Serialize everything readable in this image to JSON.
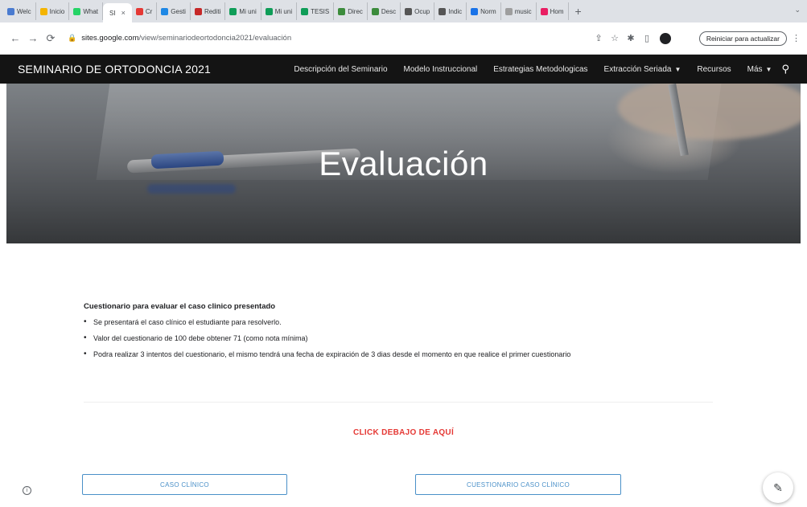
{
  "browser": {
    "tabs": [
      {
        "label": "Welc",
        "color": "#4a7bd0"
      },
      {
        "label": "Inicio",
        "color": "#f4b400"
      },
      {
        "label": "What",
        "color": "#25d366"
      },
      {
        "label": "SI",
        "color": "#ffffff",
        "active": true
      },
      {
        "label": "Cr",
        "color": "#e53935"
      },
      {
        "label": "Gesti",
        "color": "#1e88e5"
      },
      {
        "label": "Rediti",
        "color": "#c62828"
      },
      {
        "label": "Mi uni",
        "color": "#0f9d58"
      },
      {
        "label": "Mi uni",
        "color": "#0f9d58"
      },
      {
        "label": "TESIS",
        "color": "#0f9d58"
      },
      {
        "label": "Direc",
        "color": "#3c8c3c"
      },
      {
        "label": "Desc",
        "color": "#3c8c3c"
      },
      {
        "label": "Ocup",
        "color": "#555555"
      },
      {
        "label": "Indic",
        "color": "#555555"
      },
      {
        "label": "Norm",
        "color": "#1a73e8"
      },
      {
        "label": "music",
        "color": "#9e9e9e"
      },
      {
        "label": "Hom",
        "color": "#e91e63"
      }
    ],
    "active_tab_close": "×",
    "new_tab": "+",
    "url_domain": "sites.google.com",
    "url_path": "/view/seminariodeortodoncia2021/evaluación",
    "restart_label": "Reiniciar para actualizar"
  },
  "site": {
    "title": "SEMINARIO DE ORTODONCIA 2021",
    "nav": [
      {
        "label": "Descripción del Seminario"
      },
      {
        "label": "Modelo Instruccional"
      },
      {
        "label": "Estrategias Metodologicas"
      },
      {
        "label": "Extracción Seriada",
        "dropdown": true
      },
      {
        "label": "Recursos"
      },
      {
        "label": "Más",
        "dropdown": true
      }
    ],
    "nav_extraccion": "Extracción Seriada",
    "nav_recursos": "Recursos",
    "nav_mas": "Más"
  },
  "hero": {
    "title": "Evaluación"
  },
  "content": {
    "heading": "Cuestionario para evaluar el caso clinico presentado",
    "bullets": [
      "Se presentará el caso clínico el estudiante para resolverlo.",
      "Valor  del cuestionario de 100 debe obtener 71 (como nota mínima)",
      "Podra realizar 3 intentos del cuestionario, el mismo tendrá una fecha de expiración de 3 dias desde el momento en que realice el primer cuestionario"
    ]
  },
  "cta": {
    "text": "CLICK DEBAJO DE AQUÍ"
  },
  "buttons": {
    "caso": "CASO CLÍNICO",
    "cuestionario": "CUESTIONARIO CASO CLÍNICO"
  },
  "icons": {
    "back": "back-arrow-icon",
    "forward": "forward-arrow-icon",
    "reload": "reload-icon",
    "lock": "lock-icon",
    "share": "share-icon",
    "star": "star-icon",
    "extensions": "puzzle-icon",
    "sidepanel": "side-panel-icon",
    "search": "search-icon",
    "info": "info-icon",
    "edit": "pencil-icon"
  },
  "colors": {
    "nav_bg": "#141414",
    "cta": "#e53935",
    "button_border": "#4a90c8"
  }
}
